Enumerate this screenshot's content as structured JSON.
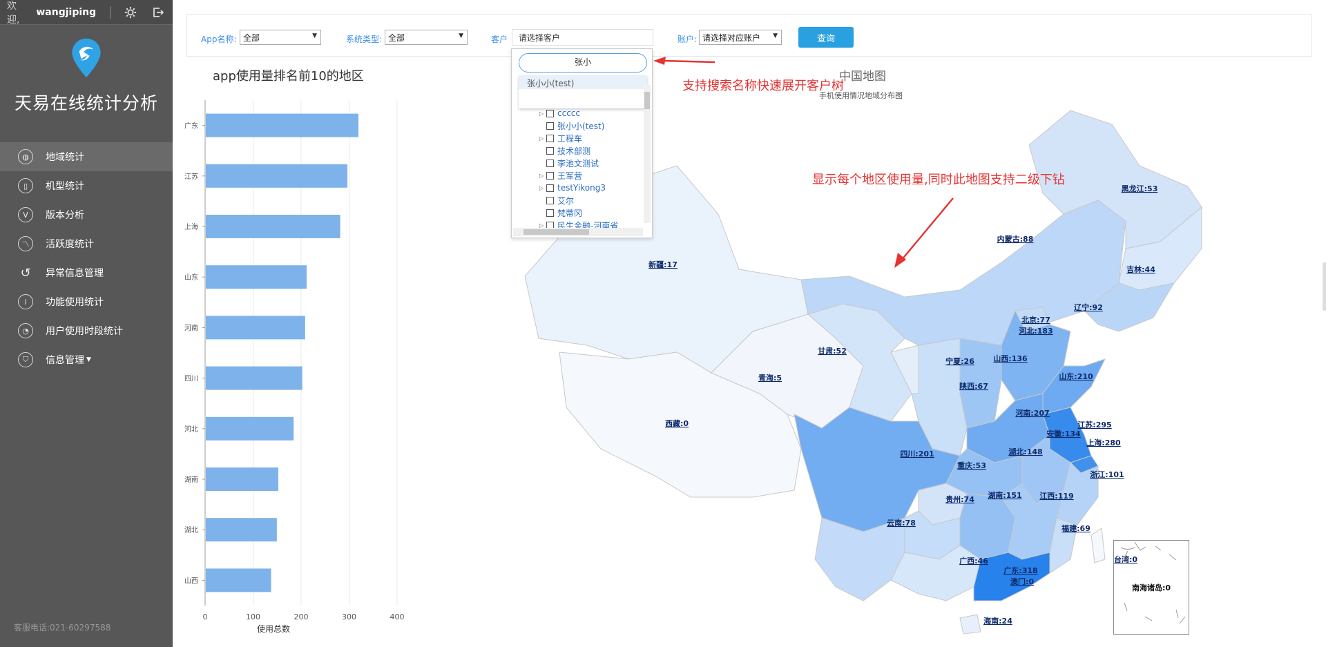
{
  "topbar": {
    "welcome": "欢迎,",
    "username": "wangjiping"
  },
  "sidebar": {
    "brand": "天易在线统计分析",
    "items": [
      {
        "label": "地域统计",
        "icon": "globe-icon"
      },
      {
        "label": "机型统计",
        "icon": "phone-icon"
      },
      {
        "label": "版本分析",
        "icon": "version-icon"
      },
      {
        "label": "活跃度统计",
        "icon": "activity-chart-icon"
      },
      {
        "label": "异常信息管理",
        "icon": "alert-icon"
      },
      {
        "label": "功能使用统计",
        "icon": "info-icon"
      },
      {
        "label": "用户使用时段统计",
        "icon": "clock-icon"
      },
      {
        "label": "信息管理",
        "icon": "shield-icon"
      }
    ],
    "service_phone": "客服电话:021-60297588"
  },
  "filters": {
    "app_label": "App名称:",
    "app_value": "全部",
    "system_label": "系统类型:",
    "system_value": "全部",
    "customer_label": "客户",
    "customer_placeholder": "请选择客户",
    "account_label": "账户:",
    "account_value": "请选择对应账户",
    "query_label": "查询"
  },
  "tree": {
    "search_value": "张小",
    "suggestion": "张小小(test)",
    "nodes": [
      {
        "label": "ccccc",
        "expandable": true
      },
      {
        "label": "张小小(test)",
        "expandable": false
      },
      {
        "label": "工程车",
        "expandable": true
      },
      {
        "label": "技术部测",
        "expandable": false
      },
      {
        "label": "李池文测试",
        "expandable": false
      },
      {
        "label": "王军营",
        "expandable": true
      },
      {
        "label": "testYikong3",
        "expandable": true
      },
      {
        "label": "艾尔",
        "expandable": false
      },
      {
        "label": "梵蒂冈",
        "expandable": false
      },
      {
        "label": "民生金融-河南省",
        "expandable": true
      }
    ]
  },
  "annotations": {
    "search": "支持搜索名称快速展开客户树",
    "map": "显示每个地区使用量,同时此地图支持二级下钻"
  },
  "chart_data": [
    {
      "type": "bar",
      "title": "app使用量排名前10的地区",
      "xlabel": "使用总数",
      "categories": [
        "广东",
        "江苏",
        "上海",
        "山东",
        "河南",
        "四川",
        "河北",
        "湖南",
        "湖北",
        "山西"
      ],
      "values": [
        318,
        295,
        280,
        210,
        207,
        201,
        183,
        151,
        148,
        136
      ],
      "xlim": [
        0,
        400
      ],
      "xticks": [
        0,
        100,
        200,
        300,
        400
      ],
      "color": "#7db3ea",
      "grid": true
    },
    {
      "type": "map",
      "title": "中国地图",
      "subtitle": "手机使用情况地域分布图",
      "regions": [
        {
          "name": "黑龙江",
          "value": 53
        },
        {
          "name": "内蒙古",
          "value": 88
        },
        {
          "name": "吉林",
          "value": 44
        },
        {
          "name": "新疆",
          "value": 17
        },
        {
          "name": "辽宁",
          "value": 92
        },
        {
          "name": "北京",
          "value": 77
        },
        {
          "name": "河北",
          "value": 183
        },
        {
          "name": "甘肃",
          "value": 52
        },
        {
          "name": "宁夏",
          "value": 26
        },
        {
          "name": "山西",
          "value": 136
        },
        {
          "name": "山东",
          "value": 210
        },
        {
          "name": "青海",
          "value": 5
        },
        {
          "name": "陕西",
          "value": 67
        },
        {
          "name": "西藏",
          "value": 0
        },
        {
          "name": "河南",
          "value": 207
        },
        {
          "name": "江苏",
          "value": 295
        },
        {
          "name": "安徽",
          "value": 134
        },
        {
          "name": "上海",
          "value": 280
        },
        {
          "name": "四川",
          "value": 201
        },
        {
          "name": "湖北",
          "value": 148
        },
        {
          "name": "重庆",
          "value": 53
        },
        {
          "name": "浙江",
          "value": 101
        },
        {
          "name": "贵州",
          "value": 74
        },
        {
          "name": "湖南",
          "value": 151
        },
        {
          "name": "江西",
          "value": 119
        },
        {
          "name": "云南",
          "value": 78
        },
        {
          "name": "福建",
          "value": 69
        },
        {
          "name": "台湾",
          "value": 0
        },
        {
          "name": "广西",
          "value": 46
        },
        {
          "name": "广东",
          "value": 318
        },
        {
          "name": "澳门",
          "value": 0
        },
        {
          "name": "海南",
          "value": 24
        },
        {
          "name": "南海诸岛",
          "value": 0
        }
      ]
    }
  ]
}
